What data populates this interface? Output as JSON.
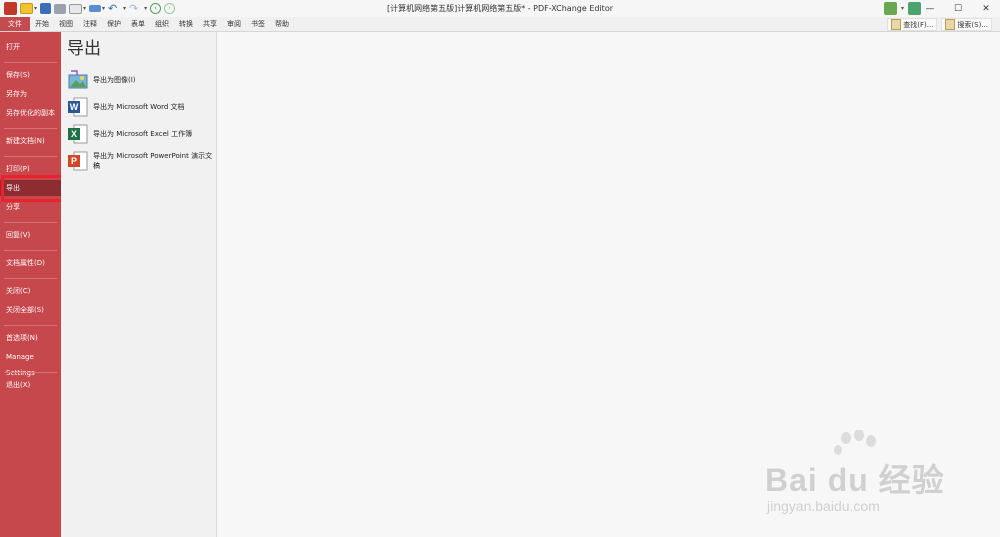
{
  "window": {
    "title": "[计算机网络第五版]计算机网络第五版* - PDF-XChange Editor",
    "controls": [
      "—",
      "☐",
      "✕"
    ]
  },
  "menubar": {
    "tabs": [
      "文件",
      "开始",
      "视图",
      "注释",
      "保护",
      "表单",
      "组织",
      "转换",
      "共享",
      "审阅",
      "书签",
      "帮助"
    ],
    "find_label": "查找(F)...",
    "search_label": "搜索(S)..."
  },
  "sidebar": {
    "items": [
      "打开",
      "保存(S)",
      "另存为",
      "另存优化的副本",
      "新建文档(N)",
      "打印(P)",
      "导出",
      "分享",
      "回复(V)",
      "文档属性(D)",
      "关闭(C)",
      "关闭全部(S)",
      "首选项(N)",
      "Manage Settings",
      "退出(X)"
    ],
    "active_index": 6
  },
  "panel": {
    "heading": "导出",
    "options": [
      {
        "label": "导出为图像(I)",
        "icon": "image-export-icon"
      },
      {
        "label": "导出为 Microsoft Word 文档",
        "icon": "word-icon"
      },
      {
        "label": "导出为 Microsoft Excel 工作簿",
        "icon": "excel-icon"
      },
      {
        "label": "导出为 Microsoft PowerPoint 演示文稿",
        "icon": "powerpoint-icon"
      }
    ]
  },
  "watermark": {
    "brand": "Bai du 经验",
    "url": "jingyan.baidu.com"
  },
  "colors": {
    "sidebar": "#c6474c",
    "active": "#8e2c31",
    "highlight": "#e8232d"
  }
}
